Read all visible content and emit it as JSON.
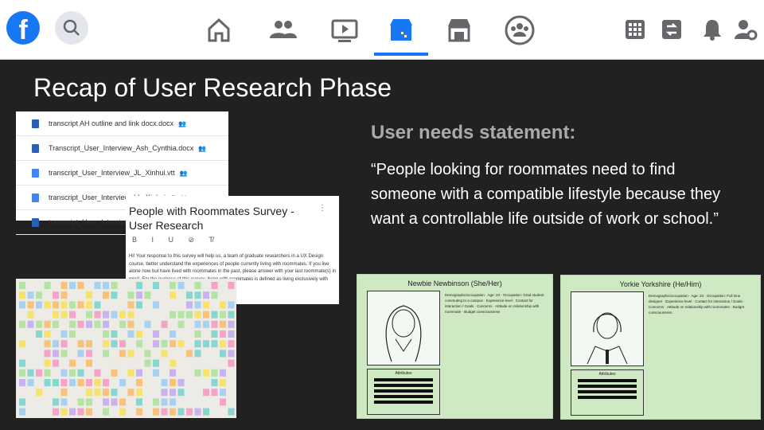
{
  "topbar": {
    "logo_letter": "f",
    "icons": [
      "facebook-logo",
      "search-icon",
      "home-icon",
      "friends-icon",
      "watch-icon",
      "marketplace-icon",
      "shop-icon",
      "groups-icon",
      "menu-grid-icon",
      "messenger-icon",
      "notifications-icon",
      "account-settings-icon"
    ],
    "accent": "#1877f2"
  },
  "slide": {
    "title": "Recap of User Research Phase",
    "needs_heading": "User needs statement:",
    "quote": "“People looking for roommates need to find someone with a compatible lifestyle because they want a controllable life outside of work or school.”"
  },
  "files": [
    {
      "name": "transcript AH outline and link docx.docx",
      "type": "word"
    },
    {
      "name": "Transcript_User_Interview_Ash_Cynthia.docx",
      "type": "word"
    },
    {
      "name": "transcript_User_Interview_JL_Xinhui.vtt",
      "type": "doc"
    },
    {
      "name": "transcript_User_Interview_LL_Xinhui.vtt",
      "type": "doc"
    },
    {
      "name": "transcript_User_Interview",
      "type": "word"
    }
  ],
  "survey": {
    "title": "People with Roommates Survey - User Research",
    "tools": "B I U ⊘ T̸",
    "body": "Hi! Your response to this survey will help us, a team of graduate researchers in a UX Design course, better understand the experiences of people currently living with roommates. If you live alone now but have lived with roommates in the past, please answer with your last roommate(s) in mind. For the purpose of this survey, living with roommates is defined as living exclusively with people who are not from your family."
  },
  "personas": [
    {
      "name": "Newbie Newbinson (She/Her)",
      "attributes_label": "Attributes",
      "text": "Demographic/occupation · Age: 23 · Occupation: Grad student commuting to a campus · Experience level · Contact for interaction / Goals · Concerns · Attitude on relationship with roommate · Budget consciousness"
    },
    {
      "name": "Yorkie Yorkshire (He/Him)",
      "attributes_label": "Attributes",
      "text": "Demographic/occupation · Age: 23 · Occupation: Full time designer · Experience level · Contact for interaction / Goals · Concerns · Attitude on relationship with roommates · Budget consciousness"
    }
  ]
}
